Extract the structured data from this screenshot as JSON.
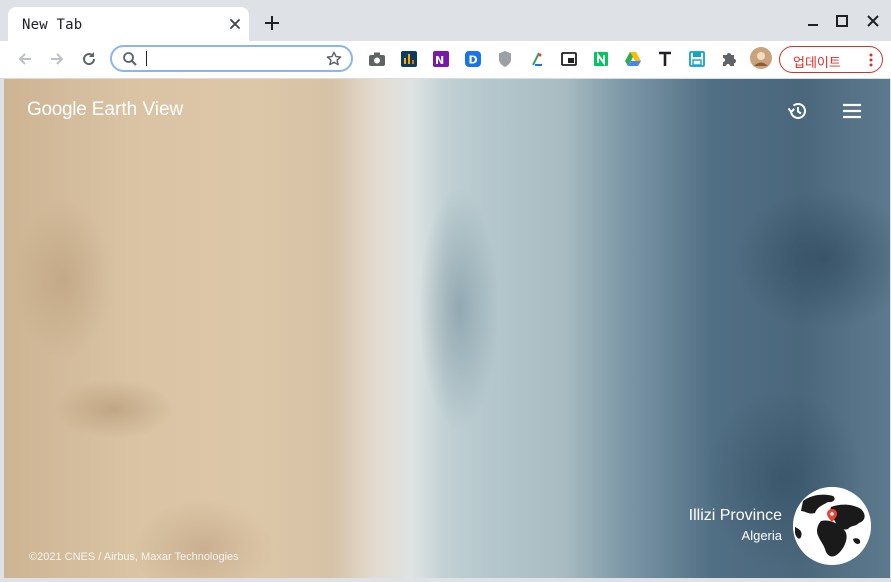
{
  "tab": {
    "title": "New Tab"
  },
  "omnibox": {
    "value": ""
  },
  "update": {
    "label": "업데이트"
  },
  "earth": {
    "logo_google": "Google",
    "logo_product": "Earth View",
    "place_name": "Illizi Province",
    "place_country": "Algeria",
    "copyright": "©2021 CNES / Airbus, Maxar Technologies"
  },
  "colors": {
    "accent": "#8ab4f8",
    "update": "#d93025"
  }
}
